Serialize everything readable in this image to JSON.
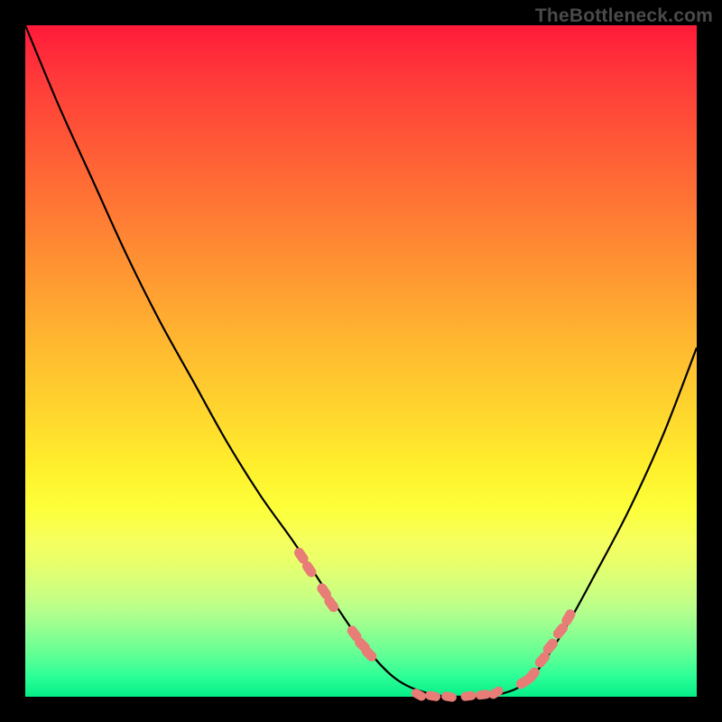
{
  "watermark": "TheBottleneck.com",
  "chart_data": {
    "type": "line",
    "x": [
      0.0,
      0.05,
      0.1,
      0.15,
      0.2,
      0.25,
      0.3,
      0.35,
      0.4,
      0.45,
      0.5,
      0.55,
      0.6,
      0.65,
      0.7,
      0.75,
      0.8,
      0.85,
      0.9,
      0.95,
      1.0
    ],
    "values": [
      1.0,
      0.88,
      0.77,
      0.66,
      0.56,
      0.47,
      0.38,
      0.3,
      0.23,
      0.155,
      0.082,
      0.028,
      0.005,
      0.0,
      0.002,
      0.025,
      0.095,
      0.185,
      0.28,
      0.39,
      0.52
    ],
    "xlabel": "",
    "ylabel": "",
    "xlim": [
      0,
      1
    ],
    "ylim": [
      0,
      1
    ],
    "title": "",
    "beads": {
      "left_arm": [
        {
          "x": 0.411,
          "y": 0.21
        },
        {
          "x": 0.423,
          "y": 0.19
        },
        {
          "x": 0.445,
          "y": 0.157
        },
        {
          "x": 0.456,
          "y": 0.138
        },
        {
          "x": 0.49,
          "y": 0.094
        },
        {
          "x": 0.502,
          "y": 0.077
        },
        {
          "x": 0.512,
          "y": 0.064
        }
      ],
      "bottom": [
        {
          "x": 0.586,
          "y": 0.003
        },
        {
          "x": 0.607,
          "y": 0.001
        },
        {
          "x": 0.631,
          "y": 0.0
        },
        {
          "x": 0.66,
          "y": 0.001
        },
        {
          "x": 0.682,
          "y": 0.003
        },
        {
          "x": 0.701,
          "y": 0.006
        }
      ],
      "right_arm": [
        {
          "x": 0.743,
          "y": 0.022
        },
        {
          "x": 0.755,
          "y": 0.032
        },
        {
          "x": 0.77,
          "y": 0.055
        },
        {
          "x": 0.782,
          "y": 0.075
        },
        {
          "x": 0.797,
          "y": 0.098
        },
        {
          "x": 0.809,
          "y": 0.118
        }
      ]
    },
    "colors": {
      "curve": "#000000",
      "beads": "#e87c77",
      "gradient_top": "#ff1a3a",
      "gradient_bottom": "#05ee87",
      "frame": "#000000"
    }
  }
}
